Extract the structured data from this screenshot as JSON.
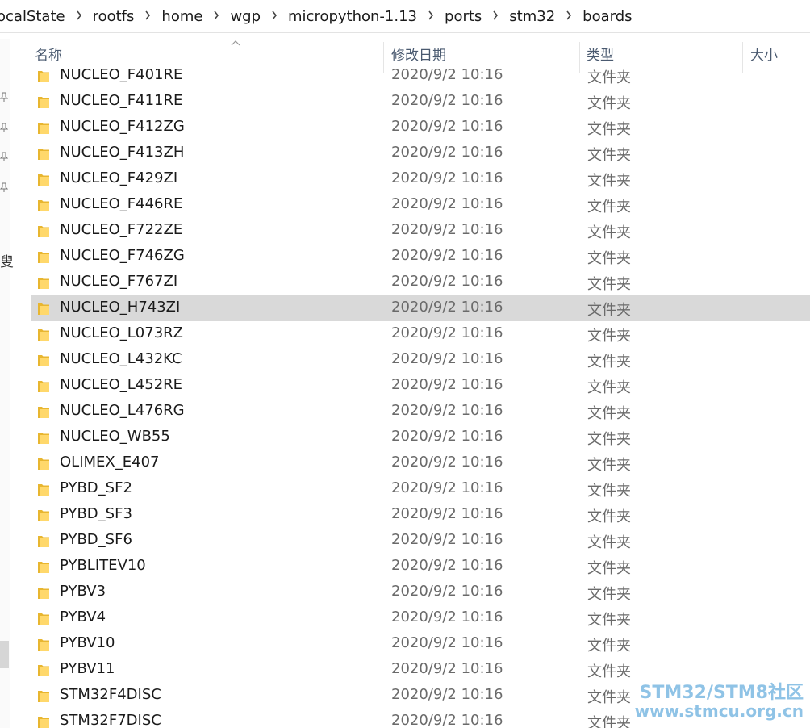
{
  "breadcrumb": [
    "ocalState",
    "rootfs",
    "home",
    "wgp",
    "micropython-1.13",
    "ports",
    "stm32",
    "boards"
  ],
  "columns": {
    "name": "名称",
    "date": "修改日期",
    "type": "类型",
    "size": "大小"
  },
  "nav_pane": {
    "partial_label": "叟"
  },
  "files": [
    {
      "name": "NUCLEO_F401RE",
      "date": "2020/9/2 10:16",
      "type": "文件夹"
    },
    {
      "name": "NUCLEO_F411RE",
      "date": "2020/9/2 10:16",
      "type": "文件夹"
    },
    {
      "name": "NUCLEO_F412ZG",
      "date": "2020/9/2 10:16",
      "type": "文件夹"
    },
    {
      "name": "NUCLEO_F413ZH",
      "date": "2020/9/2 10:16",
      "type": "文件夹"
    },
    {
      "name": "NUCLEO_F429ZI",
      "date": "2020/9/2 10:16",
      "type": "文件夹"
    },
    {
      "name": "NUCLEO_F446RE",
      "date": "2020/9/2 10:16",
      "type": "文件夹"
    },
    {
      "name": "NUCLEO_F722ZE",
      "date": "2020/9/2 10:16",
      "type": "文件夹"
    },
    {
      "name": "NUCLEO_F746ZG",
      "date": "2020/9/2 10:16",
      "type": "文件夹"
    },
    {
      "name": "NUCLEO_F767ZI",
      "date": "2020/9/2 10:16",
      "type": "文件夹"
    },
    {
      "name": "NUCLEO_H743ZI",
      "date": "2020/9/2 10:16",
      "type": "文件夹",
      "selected": true
    },
    {
      "name": "NUCLEO_L073RZ",
      "date": "2020/9/2 10:16",
      "type": "文件夹"
    },
    {
      "name": "NUCLEO_L432KC",
      "date": "2020/9/2 10:16",
      "type": "文件夹"
    },
    {
      "name": "NUCLEO_L452RE",
      "date": "2020/9/2 10:16",
      "type": "文件夹"
    },
    {
      "name": "NUCLEO_L476RG",
      "date": "2020/9/2 10:16",
      "type": "文件夹"
    },
    {
      "name": "NUCLEO_WB55",
      "date": "2020/9/2 10:16",
      "type": "文件夹"
    },
    {
      "name": "OLIMEX_E407",
      "date": "2020/9/2 10:16",
      "type": "文件夹"
    },
    {
      "name": "PYBD_SF2",
      "date": "2020/9/2 10:16",
      "type": "文件夹"
    },
    {
      "name": "PYBD_SF3",
      "date": "2020/9/2 10:16",
      "type": "文件夹"
    },
    {
      "name": "PYBD_SF6",
      "date": "2020/9/2 10:16",
      "type": "文件夹"
    },
    {
      "name": "PYBLITEV10",
      "date": "2020/9/2 10:16",
      "type": "文件夹"
    },
    {
      "name": "PYBV3",
      "date": "2020/9/2 10:16",
      "type": "文件夹"
    },
    {
      "name": "PYBV4",
      "date": "2020/9/2 10:16",
      "type": "文件夹"
    },
    {
      "name": "PYBV10",
      "date": "2020/9/2 10:16",
      "type": "文件夹"
    },
    {
      "name": "PYBV11",
      "date": "2020/9/2 10:16",
      "type": "文件夹"
    },
    {
      "name": "STM32F4DISC",
      "date": "2020/9/2 10:16",
      "type": "文件夹"
    },
    {
      "name": "STM32F7DISC",
      "date": "2020/9/2 10:16",
      "type": "文件夹"
    }
  ],
  "watermark": {
    "line1": "STM32/STM8社区",
    "line2": "www.stmcu.org.cn"
  },
  "icons": {
    "folder": "folder-icon",
    "pin": "pin-icon",
    "chevron": "chevron-right-icon",
    "sort": "sort-up-icon"
  },
  "colors": {
    "selection": "#d9d9d9",
    "folder_light": "#ffd86b",
    "folder_dark": "#e8b630",
    "header_text": "#4a5a70",
    "watermark": "#8fc3e6"
  }
}
